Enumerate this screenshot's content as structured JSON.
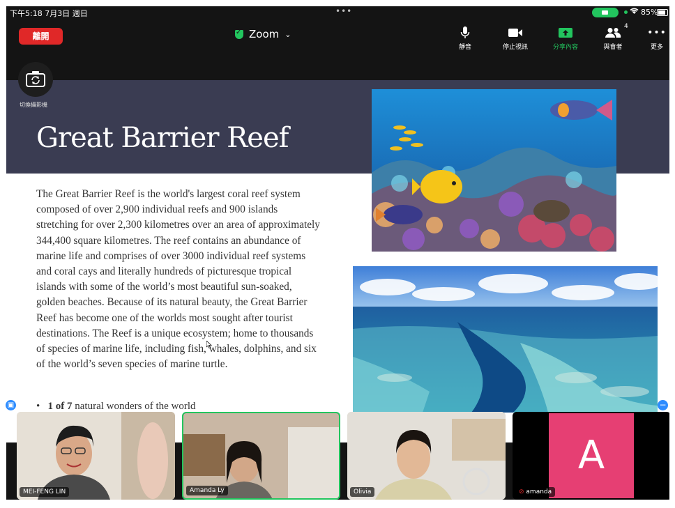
{
  "status_bar": {
    "time": "下午5:18  7月3日 週日",
    "dots": "•••",
    "battery": "85%"
  },
  "toolbar": {
    "leave_label": "離開",
    "meeting_title": "Zoom",
    "buttons": [
      {
        "label": "靜音",
        "icon": "microphone-icon"
      },
      {
        "label": "停止視訊",
        "icon": "video-camera-icon"
      },
      {
        "label": "分享內容",
        "icon": "share-screen-icon"
      },
      {
        "label": "與會者",
        "icon": "participants-icon",
        "count": "4"
      },
      {
        "label": "更多",
        "icon": "more-icon"
      }
    ]
  },
  "switch_camera_label": "切換攝影機",
  "slide": {
    "title": "Great Barrier Reef",
    "body": "The Great Barrier Reef is the world's largest coral reef system composed of over 2,900 individual reefs and 900 islands stretching for over 2,300 kilometres over an area of approximately 344,400 square kilometres. The reef contains an abundance of marine life and comprises of over 3000 individual reef systems and coral cays and literally hundreds of picturesque tropical islands with some of the world’s most beautiful sun-soaked, golden beaches. Because of its natural beauty, the Great Barrier Reef has become one of the worlds most sought after tourist destinations. The Reef is a unique ecosystem; home to thousands of species of marine life, including fish, whales, dolphins, and six of the world’s seven species of marine turtle.",
    "bullet_bold": "1 of 7",
    "bullet_rest": " natural wonders of the world"
  },
  "participants": [
    {
      "name": "MEI-FENG LIN"
    },
    {
      "name": "Amanda Ly"
    },
    {
      "name": "Olivia"
    },
    {
      "name": "amanda",
      "initial": "A",
      "avatar_color": "#e63f73",
      "muted": true
    }
  ],
  "colors": {
    "leave": "#e02828",
    "accent_green": "#22c55e",
    "slide_header": "#3a3c52",
    "zoom_blue": "#2d8cff"
  }
}
